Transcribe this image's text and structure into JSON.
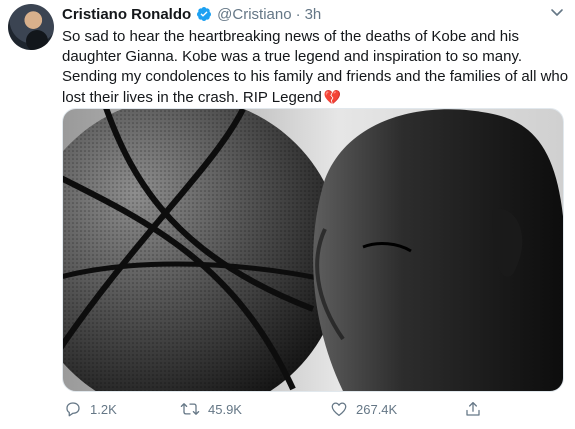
{
  "tweet": {
    "author_name": "Cristiano Ronaldo",
    "handle": "@Cristiano",
    "separator": "·",
    "time": "3h",
    "text": "So sad to hear the heartbreaking news of the deaths of Kobe and his daughter Gianna. Kobe was a true legend and inspiration to so many. Sending my condolences to his family and friends and the families of all who lost their lives in the crash. RIP Legend",
    "text_emoji": "💔"
  },
  "actions": {
    "replies": "1.2K",
    "retweets": "45.9K",
    "likes": "267.4K"
  },
  "icons": {
    "verified": "verified-badge-icon",
    "caret": "chevron-down-icon",
    "reply": "reply-icon",
    "retweet": "retweet-icon",
    "like": "heart-icon",
    "share": "share-icon"
  },
  "colors": {
    "text": "#14171a",
    "secondary": "#657786",
    "verified": "#1da1f2",
    "heart_emoji": "#e0245e"
  }
}
